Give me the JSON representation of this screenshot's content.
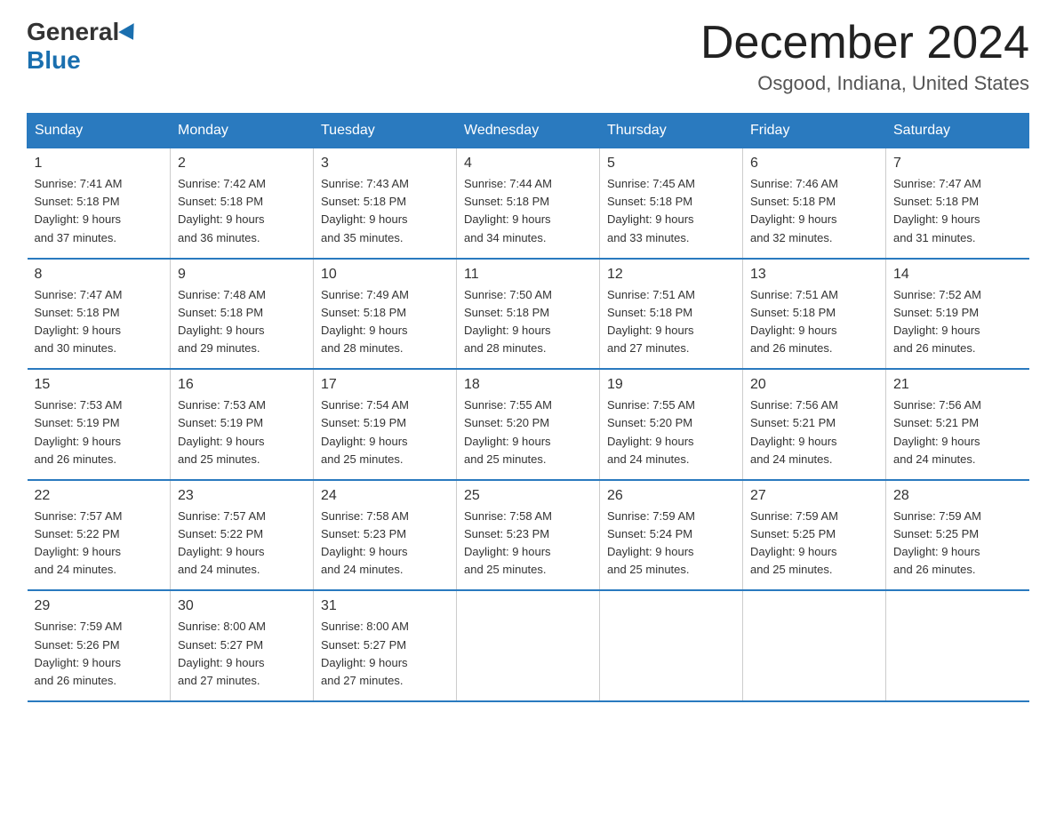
{
  "logo": {
    "general": "General",
    "blue": "Blue"
  },
  "title": "December 2024",
  "subtitle": "Osgood, Indiana, United States",
  "days_of_week": [
    "Sunday",
    "Monday",
    "Tuesday",
    "Wednesday",
    "Thursday",
    "Friday",
    "Saturday"
  ],
  "weeks": [
    [
      {
        "day": "1",
        "sunrise": "7:41 AM",
        "sunset": "5:18 PM",
        "daylight": "9 hours and 37 minutes."
      },
      {
        "day": "2",
        "sunrise": "7:42 AM",
        "sunset": "5:18 PM",
        "daylight": "9 hours and 36 minutes."
      },
      {
        "day": "3",
        "sunrise": "7:43 AM",
        "sunset": "5:18 PM",
        "daylight": "9 hours and 35 minutes."
      },
      {
        "day": "4",
        "sunrise": "7:44 AM",
        "sunset": "5:18 PM",
        "daylight": "9 hours and 34 minutes."
      },
      {
        "day": "5",
        "sunrise": "7:45 AM",
        "sunset": "5:18 PM",
        "daylight": "9 hours and 33 minutes."
      },
      {
        "day": "6",
        "sunrise": "7:46 AM",
        "sunset": "5:18 PM",
        "daylight": "9 hours and 32 minutes."
      },
      {
        "day": "7",
        "sunrise": "7:47 AM",
        "sunset": "5:18 PM",
        "daylight": "9 hours and 31 minutes."
      }
    ],
    [
      {
        "day": "8",
        "sunrise": "7:47 AM",
        "sunset": "5:18 PM",
        "daylight": "9 hours and 30 minutes."
      },
      {
        "day": "9",
        "sunrise": "7:48 AM",
        "sunset": "5:18 PM",
        "daylight": "9 hours and 29 minutes."
      },
      {
        "day": "10",
        "sunrise": "7:49 AM",
        "sunset": "5:18 PM",
        "daylight": "9 hours and 28 minutes."
      },
      {
        "day": "11",
        "sunrise": "7:50 AM",
        "sunset": "5:18 PM",
        "daylight": "9 hours and 28 minutes."
      },
      {
        "day": "12",
        "sunrise": "7:51 AM",
        "sunset": "5:18 PM",
        "daylight": "9 hours and 27 minutes."
      },
      {
        "day": "13",
        "sunrise": "7:51 AM",
        "sunset": "5:18 PM",
        "daylight": "9 hours and 26 minutes."
      },
      {
        "day": "14",
        "sunrise": "7:52 AM",
        "sunset": "5:19 PM",
        "daylight": "9 hours and 26 minutes."
      }
    ],
    [
      {
        "day": "15",
        "sunrise": "7:53 AM",
        "sunset": "5:19 PM",
        "daylight": "9 hours and 26 minutes."
      },
      {
        "day": "16",
        "sunrise": "7:53 AM",
        "sunset": "5:19 PM",
        "daylight": "9 hours and 25 minutes."
      },
      {
        "day": "17",
        "sunrise": "7:54 AM",
        "sunset": "5:19 PM",
        "daylight": "9 hours and 25 minutes."
      },
      {
        "day": "18",
        "sunrise": "7:55 AM",
        "sunset": "5:20 PM",
        "daylight": "9 hours and 25 minutes."
      },
      {
        "day": "19",
        "sunrise": "7:55 AM",
        "sunset": "5:20 PM",
        "daylight": "9 hours and 24 minutes."
      },
      {
        "day": "20",
        "sunrise": "7:56 AM",
        "sunset": "5:21 PM",
        "daylight": "9 hours and 24 minutes."
      },
      {
        "day": "21",
        "sunrise": "7:56 AM",
        "sunset": "5:21 PM",
        "daylight": "9 hours and 24 minutes."
      }
    ],
    [
      {
        "day": "22",
        "sunrise": "7:57 AM",
        "sunset": "5:22 PM",
        "daylight": "9 hours and 24 minutes."
      },
      {
        "day": "23",
        "sunrise": "7:57 AM",
        "sunset": "5:22 PM",
        "daylight": "9 hours and 24 minutes."
      },
      {
        "day": "24",
        "sunrise": "7:58 AM",
        "sunset": "5:23 PM",
        "daylight": "9 hours and 24 minutes."
      },
      {
        "day": "25",
        "sunrise": "7:58 AM",
        "sunset": "5:23 PM",
        "daylight": "9 hours and 25 minutes."
      },
      {
        "day": "26",
        "sunrise": "7:59 AM",
        "sunset": "5:24 PM",
        "daylight": "9 hours and 25 minutes."
      },
      {
        "day": "27",
        "sunrise": "7:59 AM",
        "sunset": "5:25 PM",
        "daylight": "9 hours and 25 minutes."
      },
      {
        "day": "28",
        "sunrise": "7:59 AM",
        "sunset": "5:25 PM",
        "daylight": "9 hours and 26 minutes."
      }
    ],
    [
      {
        "day": "29",
        "sunrise": "7:59 AM",
        "sunset": "5:26 PM",
        "daylight": "9 hours and 26 minutes."
      },
      {
        "day": "30",
        "sunrise": "8:00 AM",
        "sunset": "5:27 PM",
        "daylight": "9 hours and 27 minutes."
      },
      {
        "day": "31",
        "sunrise": "8:00 AM",
        "sunset": "5:27 PM",
        "daylight": "9 hours and 27 minutes."
      },
      null,
      null,
      null,
      null
    ]
  ]
}
